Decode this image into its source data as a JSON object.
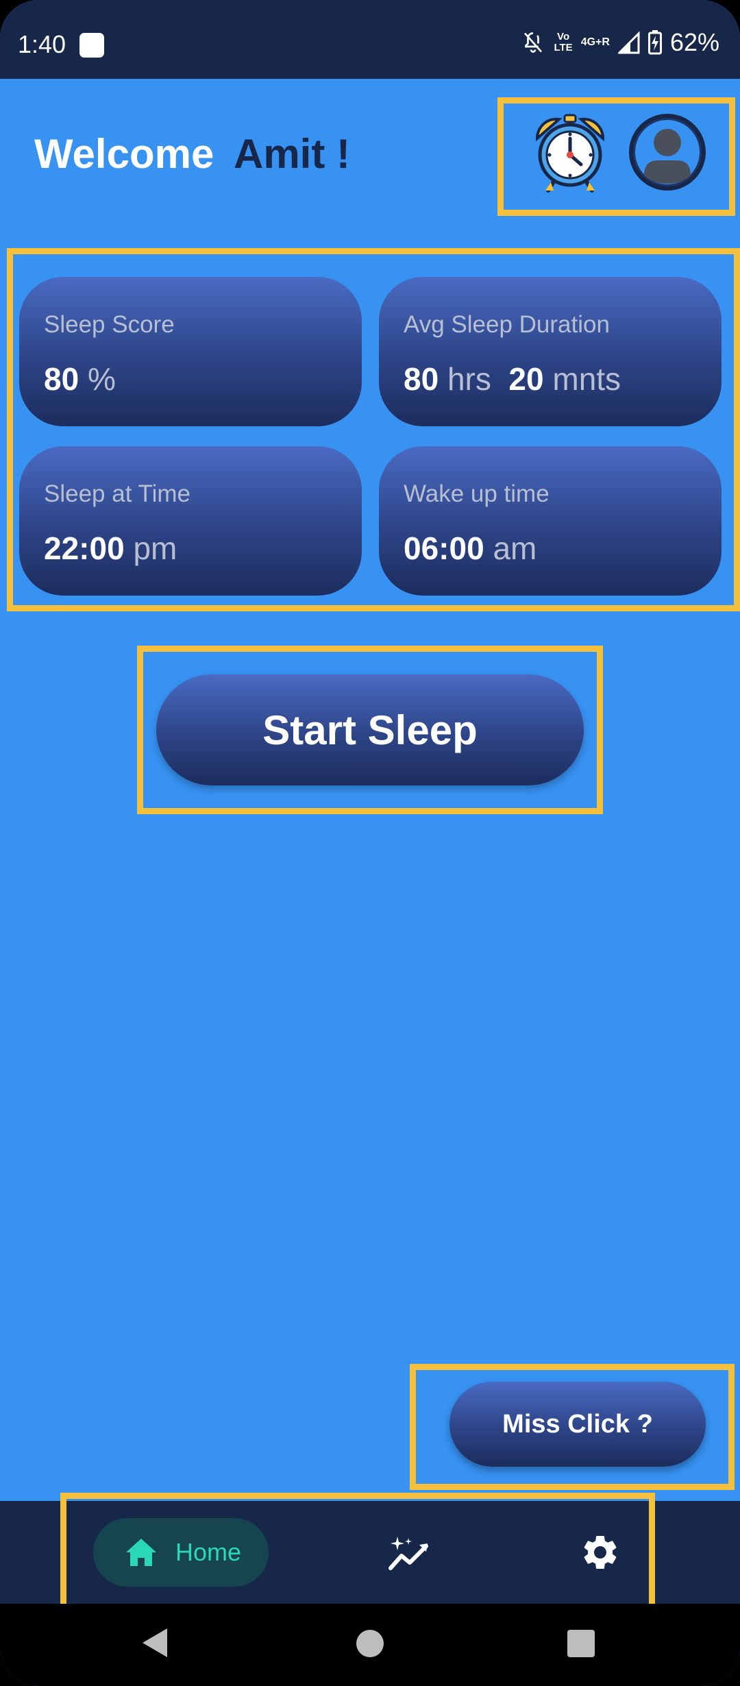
{
  "status_bar": {
    "time": "1:40",
    "network_top": "Vo",
    "network_bottom": "LTE",
    "network_type": "4G+R",
    "battery": "62%"
  },
  "header": {
    "welcome": "Welcome",
    "name": "Amit !",
    "alarm_icon": "alarm-clock-icon",
    "avatar_icon": "user-avatar-icon"
  },
  "cards": {
    "sleep_score": {
      "title": "Sleep Score",
      "value": "80",
      "unit": "%"
    },
    "avg_duration": {
      "title": "Avg Sleep Duration",
      "hours": "80",
      "hours_unit": "hrs",
      "minutes": "20",
      "minutes_unit": "mnts"
    },
    "sleep_time": {
      "title": "Sleep at Time",
      "value": "22:00",
      "unit": "pm"
    },
    "wake_time": {
      "title": "Wake up time",
      "value": "06:00",
      "unit": "am"
    }
  },
  "actions": {
    "start_sleep": "Start Sleep",
    "miss_click": "Miss Click ?"
  },
  "bottom_nav": {
    "home_label": "Home",
    "insights_icon": "sparkle-chart-icon",
    "settings_icon": "gear-icon"
  },
  "colors": {
    "background": "#3792f2",
    "dark_navy": "#17274a",
    "highlight": "#f5c13c",
    "nav_active": "#2bd8b6"
  }
}
